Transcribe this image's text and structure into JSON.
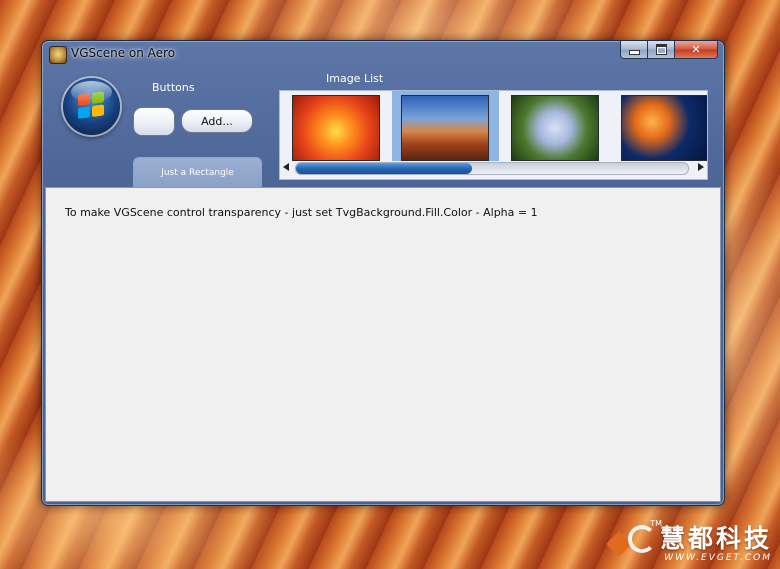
{
  "window": {
    "title": "VGScene on Aero"
  },
  "buttons_section": {
    "label": "Buttons",
    "add_button": "Add..."
  },
  "tab": {
    "label": "Just a Rectangle"
  },
  "image_list": {
    "label": "Image List",
    "items": [
      {
        "name": "red-flower-image",
        "selected": false
      },
      {
        "name": "desert-mesa-image",
        "selected": true
      },
      {
        "name": "hydrangea-image",
        "selected": false
      },
      {
        "name": "jellyfish-image",
        "selected": false
      }
    ],
    "scroll_position": 0.45
  },
  "content": {
    "text": "To make VGScene control transparency - just set TvgBackground.Fill.Color - Alpha = 1"
  },
  "watermark": {
    "text": "慧都科技",
    "url": "WWW.EVGET.COM",
    "tm": "TM"
  }
}
